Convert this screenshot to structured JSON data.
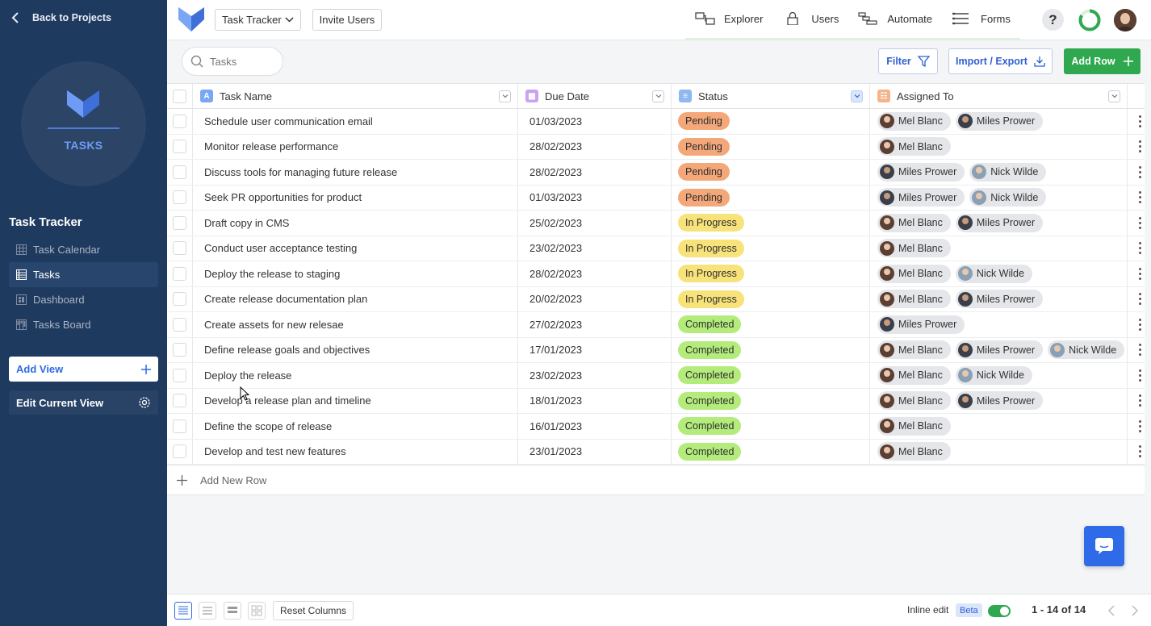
{
  "sidebar": {
    "back_label": "Back to Projects",
    "app_badge": "TASKS",
    "app_title": "Task Tracker",
    "items": [
      {
        "label": "Task Calendar",
        "icon": "calendar-grid-icon"
      },
      {
        "label": "Tasks",
        "icon": "table-icon"
      },
      {
        "label": "Dashboard",
        "icon": "dashboard-icon"
      },
      {
        "label": "Tasks Board",
        "icon": "board-icon"
      }
    ],
    "active_item": "Tasks",
    "add_view_label": "Add View",
    "edit_view_label": "Edit Current View"
  },
  "topbar": {
    "app_select_value": "Task Tracker",
    "invite_label": "Invite Users",
    "nav": [
      {
        "label": "Explorer",
        "icon": "explorer-icon"
      },
      {
        "label": "Users",
        "icon": "lock-icon"
      },
      {
        "label": "Automate",
        "icon": "automate-icon"
      },
      {
        "label": "Forms",
        "icon": "forms-icon"
      }
    ],
    "help_label": "?"
  },
  "toolbar": {
    "search_placeholder": "Tasks",
    "filter_label": "Filter",
    "import_export_label": "Import / Export",
    "add_row_label": "Add Row"
  },
  "table": {
    "columns": [
      {
        "label": "Task Name",
        "icon_glyph": "A",
        "icon_color": "#7aa7f5"
      },
      {
        "label": "Due Date",
        "icon_glyph": "▦",
        "icon_color": "#c9a4ee"
      },
      {
        "label": "Status",
        "icon_glyph": "≡",
        "icon_color": "#8fb8f0"
      },
      {
        "label": "Assigned To",
        "icon_glyph": "☷",
        "icon_color": "#f2b48a"
      }
    ],
    "rows": [
      {
        "task": "Schedule user communication email",
        "due": "01/03/2023",
        "status": "Pending",
        "assigned": [
          "Mel Blanc",
          "Miles Prower"
        ]
      },
      {
        "task": "Monitor release performance",
        "due": "28/02/2023",
        "status": "Pending",
        "assigned": [
          "Mel Blanc"
        ]
      },
      {
        "task": "Discuss tools for managing future release",
        "due": "28/02/2023",
        "status": "Pending",
        "assigned": [
          "Miles Prower",
          "Nick Wilde"
        ]
      },
      {
        "task": "Seek PR opportunities for product",
        "due": "01/03/2023",
        "status": "Pending",
        "assigned": [
          "Miles Prower",
          "Nick Wilde"
        ]
      },
      {
        "task": "Draft copy in CMS",
        "due": "25/02/2023",
        "status": "In Progress",
        "assigned": [
          "Mel Blanc",
          "Miles Prower"
        ]
      },
      {
        "task": "Conduct user acceptance testing",
        "due": "23/02/2023",
        "status": "In Progress",
        "assigned": [
          "Mel Blanc"
        ]
      },
      {
        "task": "Deploy the release to staging",
        "due": "28/02/2023",
        "status": "In Progress",
        "assigned": [
          "Mel Blanc",
          "Nick Wilde"
        ]
      },
      {
        "task": "Create release documentation plan",
        "due": "20/02/2023",
        "status": "In Progress",
        "assigned": [
          "Mel Blanc",
          "Miles Prower"
        ]
      },
      {
        "task": "Create assets for new relesae",
        "due": "27/02/2023",
        "status": "Completed",
        "assigned": [
          "Miles Prower"
        ]
      },
      {
        "task": "Define release goals and objectives",
        "due": "17/01/2023",
        "status": "Completed",
        "assigned": [
          "Mel Blanc",
          "Miles Prower",
          "Nick Wilde"
        ]
      },
      {
        "task": "Deploy the release",
        "due": "23/02/2023",
        "status": "Completed",
        "assigned": [
          "Mel Blanc",
          "Nick Wilde"
        ]
      },
      {
        "task": "Develop a release plan and timeline",
        "due": "18/01/2023",
        "status": "Completed",
        "assigned": [
          "Mel Blanc",
          "Miles Prower"
        ]
      },
      {
        "task": "Define the scope of release",
        "due": "16/01/2023",
        "status": "Completed",
        "assigned": [
          "Mel Blanc"
        ]
      },
      {
        "task": "Develop and test new features",
        "due": "23/01/2023",
        "status": "Completed",
        "assigned": [
          "Mel Blanc"
        ]
      }
    ],
    "add_row_label": "Add New Row"
  },
  "status_colors": {
    "Pending": "#f4a87a",
    "In Progress": "#f8e37a",
    "Completed": "#b4ec7c"
  },
  "footer": {
    "reset_columns_label": "Reset Columns",
    "inline_edit_label": "Inline edit",
    "beta_label": "Beta",
    "inline_edit_on": true,
    "pagination": "1 - 14 of 14"
  },
  "colors": {
    "sidebar_bg": "#1f3a5f",
    "accent_blue": "#2f6be0",
    "add_row_green": "#2fa84f"
  }
}
